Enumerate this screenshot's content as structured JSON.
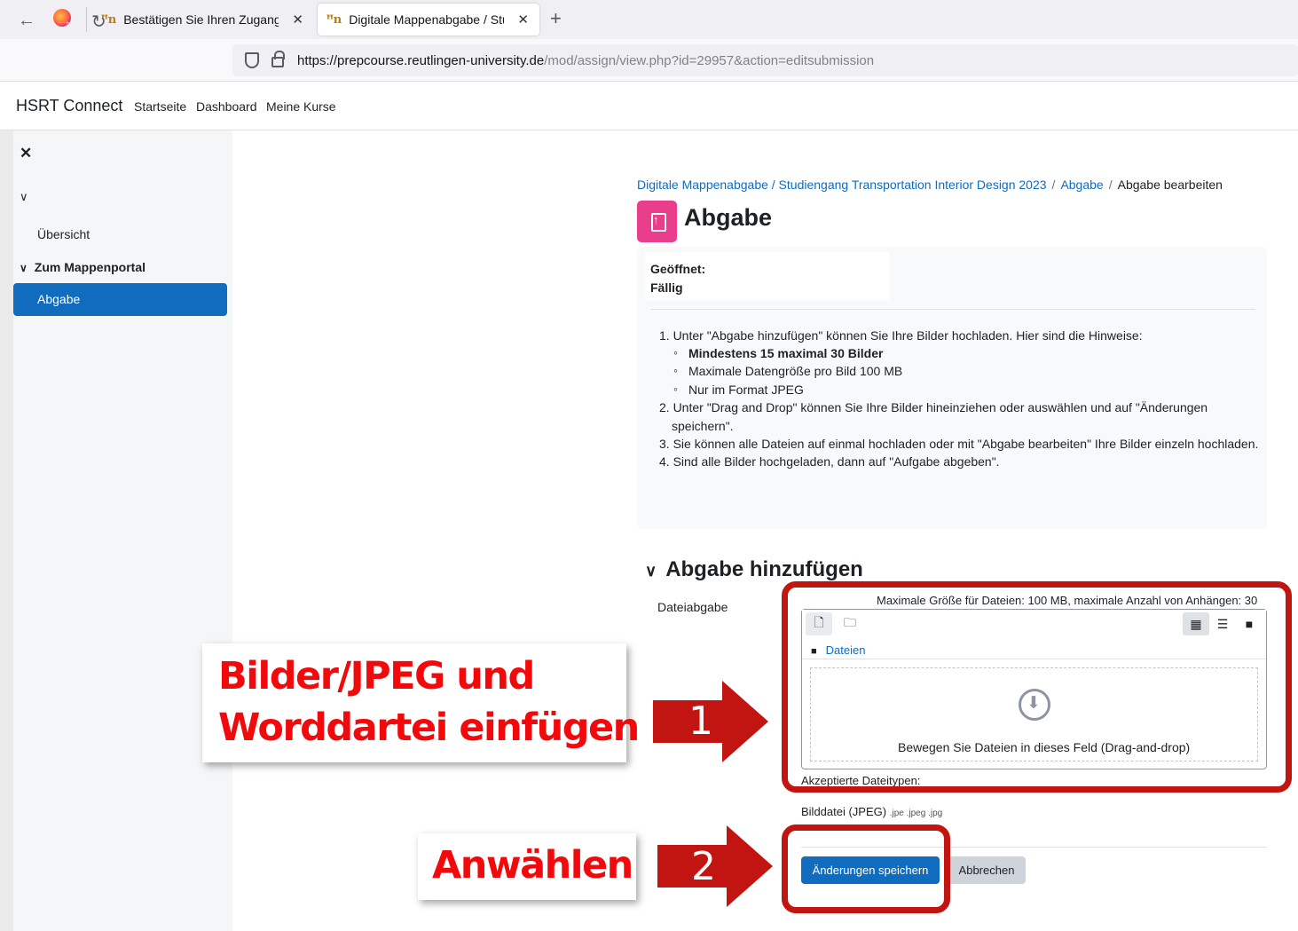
{
  "browser": {
    "tabs": [
      {
        "title": "Bestätigen Sie Ihren Zugang",
        "favicon_text": "ꟸn"
      },
      {
        "title": "Digitale Mappenabgabe / Studi",
        "favicon_text": "ꟸn"
      }
    ],
    "url_host": "https://prepcourse.reutlingen-university.de",
    "url_path": "/mod/assign/view.php?id=29957&action=editsubmission"
  },
  "header": {
    "brand": "HSRT Connect",
    "nav": [
      "Startseite",
      "Dashboard",
      "Meine Kurse"
    ]
  },
  "sidebar": {
    "items": [
      {
        "label": "Übersicht"
      },
      {
        "label": "Zum Mappenportal"
      },
      {
        "label": "Abgabe",
        "active": true
      }
    ]
  },
  "breadcrumb": {
    "items": [
      "Digitale Mappenabgabe / Studiengang Transportation Interior Design 2023",
      "Abgabe",
      "Abgabe bearbeiten"
    ]
  },
  "page": {
    "title": "Abgabe",
    "opened_label": "Geöffnet:",
    "due_label": "Fällig"
  },
  "instructions": {
    "item1": "1. Unter \"Abgabe hinzufügen\" können Sie Ihre Bilder hochladen. Hier sind die Hinweise:",
    "sub1": "Mindestens 15 maximal 30 Bilder",
    "sub2": "Maximale Datengröße pro Bild 100 MB",
    "sub3": "Nur im Format JPEG",
    "item2a": "2. Unter \"Drag and Drop\" können Sie Ihre Bilder hineinziehen oder auswählen und auf \"Änderungen",
    "item2b": "speichern\".",
    "item3": "3. Sie können alle Dateien auf einmal hochladen oder mit \"Abgabe bearbeiten\" Ihre Bilder einzeln hochladen.",
    "item4": "4. Sind alle Bilder hochgeladen, dann auf \"Aufgabe abgeben\"."
  },
  "form": {
    "section_title": "Abgabe hinzufügen",
    "field_label": "Dateiabgabe",
    "max_info": "Maximale Größe für Dateien: 100 MB, maximale Anzahl von Anhängen: 30",
    "folder": "Dateien",
    "drop_text": "Bewegen Sie Dateien in dieses Feld (Drag-and-drop)",
    "accepted_label": "Akzeptierte Dateitypen:",
    "filetype_name": "Bilddatei (JPEG)",
    "filetype_ext": ".jpe .jpeg .jpg",
    "save_label": "Änderungen speichern",
    "cancel_label": "Abbrechen"
  },
  "annotations": {
    "callout1_line1": "Bilder/JPEG und",
    "callout1_line2": "Worddartei einfügen",
    "arrow1": "1",
    "callout2": "Anwählen",
    "arrow2": "2",
    "highlight_color": "#c21410",
    "text_color": "#f2090c"
  },
  "colors": {
    "primary": "#0f6cbf",
    "activity_icon": "#e83e8c"
  }
}
